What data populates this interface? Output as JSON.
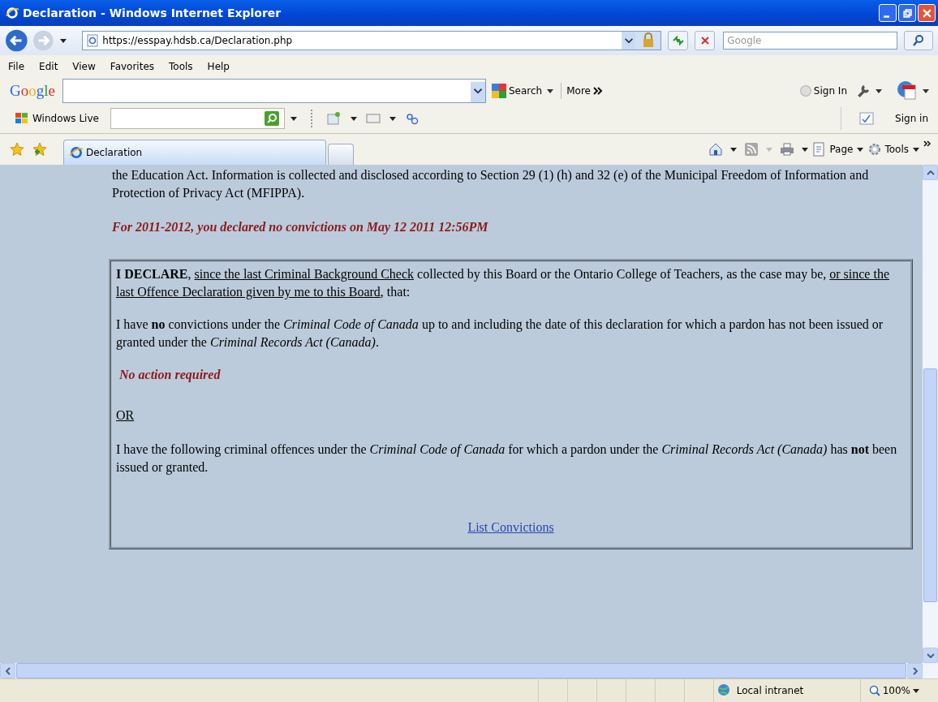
{
  "window": {
    "title": "Declaration - Windows Internet Explorer"
  },
  "address_bar": {
    "url": "https://esspay.hdsb.ca/Declaration.php",
    "search_placeholder": "Google"
  },
  "menu": [
    "File",
    "Edit",
    "View",
    "Favorites",
    "Tools",
    "Help"
  ],
  "google_toolbar": {
    "logo": "Google",
    "search": "Search",
    "more": "More",
    "sign_in": "Sign In"
  },
  "live_toolbar": {
    "label": "Windows Live",
    "sign_in": "Sign in"
  },
  "tabs": [
    {
      "label": "Declaration",
      "selected": true
    }
  ],
  "command_bar": [
    "Page",
    "Tools"
  ],
  "page": {
    "intro": "the Education Act. Information is collected and disclosed according to Section 29 (1) (h) and 32 (e) of the Municipal Freedom of Information and Protection of Privacy Act (MFIPPA).",
    "notice": "For 2011-2012, you declared no convictions on May 12 2011 12:56PM",
    "declaration": [
      {
        "kind": "bold",
        "text": "I DECLARE"
      },
      {
        "kind": "plain",
        "text": ", "
      },
      {
        "kind": "underline",
        "text": "since the last Criminal Background Check"
      },
      {
        "kind": "plain",
        "text": " collected by this Board or the Ontario College of Teachers, as the case may be, "
      },
      {
        "kind": "underline",
        "text": "or since the last Offence Declaration given by me to this Board"
      },
      {
        "kind": "plain",
        "text": ", that:"
      }
    ],
    "no_convictions": "I have **no** convictions under the *Criminal Code of Canada* up to and including the date of this declaration for which a pardon has not been issued or granted under the *Criminal Records Act (Canada)*.",
    "action": "No action required",
    "or": "OR",
    "offences": "I have the following criminal offences under the *Criminal Code of Canada* for which a pardon under the *Criminal Records Act (Canada)* has **not** been issued or granted.",
    "link": "List Convictions"
  },
  "status_bar": {
    "zone": "Local intranet",
    "zoom": "100%"
  }
}
